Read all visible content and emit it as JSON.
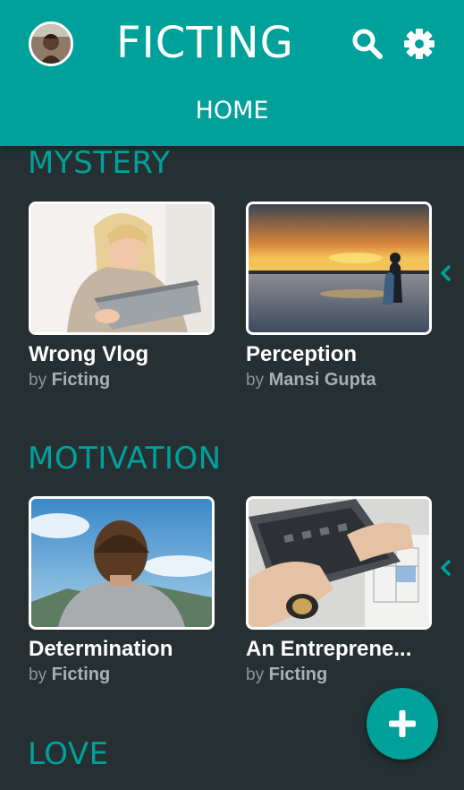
{
  "app": {
    "title": "FICTING"
  },
  "header": {
    "avatar_icon": "user-avatar",
    "search_icon": "search-icon",
    "settings_icon": "gear-icon",
    "tab": "HOME"
  },
  "sections": [
    {
      "title": "MYSTERY",
      "stories": [
        {
          "title": "Wrong Vlog",
          "by": "by",
          "author": "Ficting",
          "image": "woman-with-laptop"
        },
        {
          "title": "Perception",
          "by": "by",
          "author": "Mansi Gupta",
          "image": "couple-at-sunset"
        }
      ]
    },
    {
      "title": "MOTIVATION",
      "stories": [
        {
          "title": "Determination",
          "by": "by",
          "author": "Ficting",
          "image": "man-looking-at-sky"
        },
        {
          "title": "An Entreprene...",
          "by": "by",
          "author": "Ficting",
          "image": "hands-on-laptop"
        }
      ]
    },
    {
      "title": "LOVE",
      "stories": []
    }
  ],
  "fab": {
    "icon": "plus-icon"
  },
  "colors": {
    "accent": "#00a19a",
    "background": "#263033",
    "text": "#ffffff",
    "muted": "#8c969a"
  }
}
